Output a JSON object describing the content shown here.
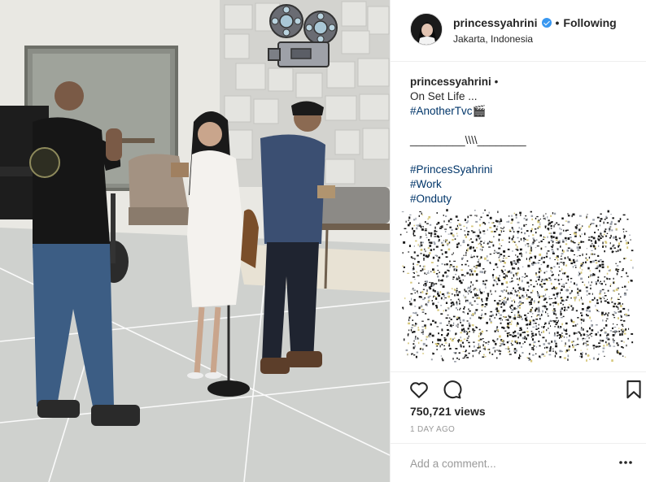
{
  "post": {
    "username": "princessyahrini",
    "follow_separator": "•",
    "follow_state": "Following",
    "location": "Jakarta, Indonesia"
  },
  "caption": {
    "username": "princessyahrini",
    "username_separator": "•",
    "lines": [
      "On Set Life ...",
      "#AnotherTvc🎬",
      "",
      "_________\\\\\\\\________",
      "",
      "#PrincesSyahrini",
      "#Work",
      "#Onduty"
    ]
  },
  "stats": {
    "views": "750,721 views",
    "time_ago": "1 DAY AGO"
  },
  "comment": {
    "placeholder": "Add a comment..."
  },
  "icons": {
    "like": "heart-icon",
    "comment": "comment-bubble-icon",
    "save": "bookmark-icon",
    "more": "more-options-icon",
    "verified": "verified-badge-icon",
    "overlay": "film-projector-icon"
  },
  "colors": {
    "hashtag": "#003569",
    "verified": "#3897f0",
    "muted": "#999999",
    "text": "#262626"
  }
}
